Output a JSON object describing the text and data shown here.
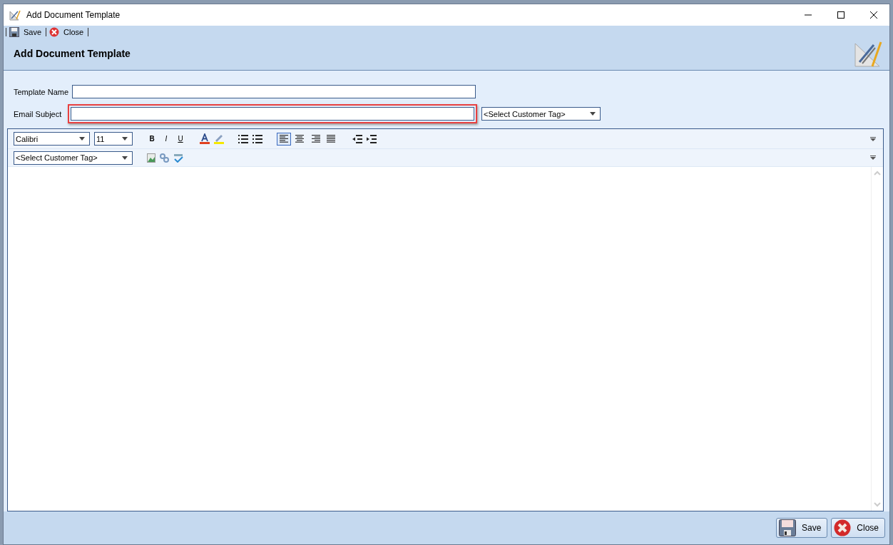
{
  "window": {
    "title": "Add Document Template"
  },
  "toolbar": [
    "Save",
    "Close"
  ],
  "header": "Add Document Template",
  "form": {
    "template_name": {
      "label": "Template Name"
    },
    "email_subject": {
      "label": "Email Subject",
      "highlighted": true
    },
    "subject_tag": "<Select Customer Tag>"
  },
  "editor": {
    "font": "Calibri",
    "size": "11",
    "format_buttons": [
      {
        "label": "B",
        "kind": "bold"
      },
      {
        "label": "I",
        "kind": "italic"
      },
      {
        "label": "U",
        "kind": "underline"
      }
    ],
    "alignments": [
      {
        "kind": "left",
        "selected": true
      },
      {
        "kind": "center",
        "selected": false
      },
      {
        "kind": "right",
        "selected": false
      },
      {
        "kind": "justify",
        "selected": false
      }
    ],
    "customer_tag": "<Select Customer Tag>"
  },
  "footer_buttons": [
    {
      "label": "Save",
      "kind": "save"
    },
    {
      "label": "Close",
      "kind": "close"
    }
  ]
}
